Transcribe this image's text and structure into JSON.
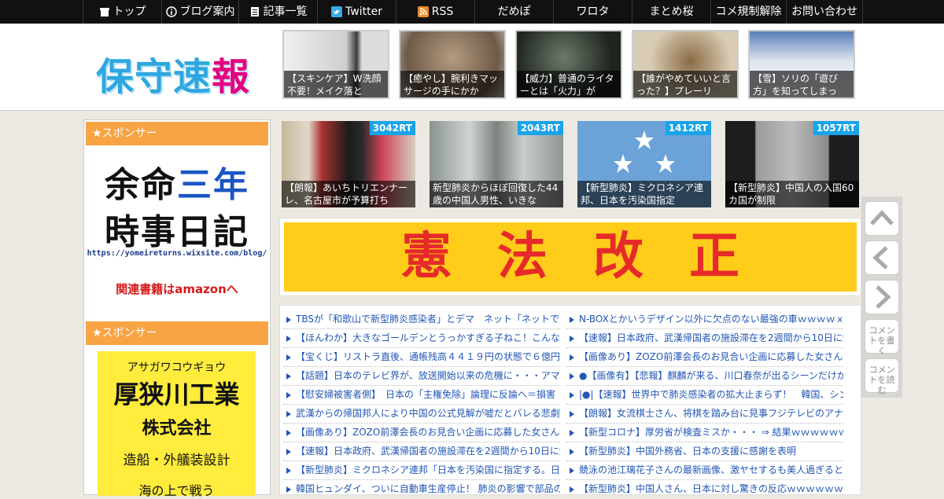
{
  "nav": {
    "items": [
      {
        "label": "トップ",
        "icon": "home-icon"
      },
      {
        "label": "ブログ案内",
        "icon": "info-icon"
      },
      {
        "label": "記事一覧",
        "icon": "list-icon"
      },
      {
        "label": "Twitter",
        "icon": "twitter-icon"
      },
      {
        "label": "RSS",
        "icon": "rss-icon"
      },
      {
        "label": "だめぽ",
        "icon": ""
      },
      {
        "label": "ワロタ",
        "icon": ""
      },
      {
        "label": "まとめ桜",
        "icon": ""
      },
      {
        "label": "コメ規制解除",
        "icon": ""
      },
      {
        "label": "お問い合わせ",
        "icon": ""
      }
    ]
  },
  "header": {
    "logo": [
      "保",
      "守",
      "速",
      "報"
    ],
    "pickups": [
      {
        "caption": "【スキンケア】W洗顔不要！メイク落と",
        "color": "#d9d9d9"
      },
      {
        "caption": "【癒やし】腕利きマッサージの手にかか",
        "color": "#8a7a6a"
      },
      {
        "caption": "【威力】普通のライターとは「火力」が",
        "color": "#3b4a3c"
      },
      {
        "caption": "【誰がやめていいと言った？】プレーリ",
        "color": "#b7a58a"
      },
      {
        "caption": "【雪】ソリの「遊び方」を知ってしまっ",
        "color": "#aebdd6"
      }
    ]
  },
  "sidebar": {
    "sponsor_heading_1": "★スポンサー",
    "sponsor_heading_2": "★スポンサー",
    "ad1": {
      "line1_a": "余命",
      "line1_b": "三年",
      "line2": "時事日記",
      "url": "https://yomeireturns.wixsite.com/blog/",
      "amazon": "関連書籍はamazonへ"
    },
    "ad2": {
      "kana": "アサガワコウギョウ",
      "name": "厚狭川工業",
      "corp": "株式会社",
      "desc": "造船・外艤装設計",
      "tail": "海の上で戦う"
    }
  },
  "ranking": [
    {
      "rt": "3042RT",
      "caption": "【朗報】あいちトリエンナーレ、名古屋市が予算打ち",
      "color": "#8b2a2a"
    },
    {
      "rt": "2043RT",
      "caption": "新型肺炎からほぼ回復した44歳の中国人男性、いきな",
      "color": "#9aa3a0"
    },
    {
      "rt": "1412RT",
      "caption": "【新型肺炎】ミクロネシア連邦、日本を汚染国指定",
      "color": "#6aa3d6"
    },
    {
      "rt": "1057RT",
      "caption": "【新型肺炎】中国人の入国60カ国が制限",
      "color": "#555555"
    }
  ],
  "banner": {
    "text": "憲法改正"
  },
  "headlines": {
    "left": [
      "TBSが「和歌山で新型肺炎感染者」とデマ　ネット「ネットで",
      "【ほんわか】大きなゴールデンとうっかすぎる子ねこ！こんな",
      "【宝くじ】リストラ直後、通帳残高４４１９円の状態で６億円",
      "【話題】日本のテレビ界が、放送開始以来の危機に・・・アマ",
      "【慰安婦被害者側】　日本の「主権免除」論理に反論へ＝損害",
      "武漢からの帰国邦人により中国の公式見解が嘘だとバレる悲劇",
      "【画像あり】ZOZO前澤会長のお見合い企画に応募した女さん、",
      "【速報】日本政府、武漢帰国者の施設滞在を2週間から10日に短",
      "【新型肺炎】ミクロネシア連邦「日本を汚染国に指定する。日",
      "韓国ヒュンダイ、ついに自動車生産停止！ 肺炎の影響で部品の"
    ],
    "right": [
      "N-BOXとかいうデザイン以外に欠点のない最強の車ｗｗｗｗｘ",
      "【速報】日本政府、武漢帰国者の施設滞在を2週間から10日に短",
      "【画像あり】ZOZO前澤会長のお見合い企画に応募した女さん、",
      "●【画像有】【悲報】麒麟が来る、川口春奈が出るシーンだけが",
      "|●|【速報】世界中で肺炎感染者の拡大止まらず！　韓国、シン",
      "【朗報】女流棋士さん、将棋を踏み台に見事フジテレビのアナ",
      "【新型コロナ】厚労省が検査ミスか・・・ ⇒ 結果ｗｗｗｗｗｗ",
      "【新型肺炎】中国外務省、日本の支援に感謝を表明",
      "競泳の池江璃花子さんの最新画像、激ヤセするも美人過ぎると",
      "【新型肺炎】中国人さん、日本に対し驚きの反応ｗｗｗｗｗｗ"
    ]
  },
  "sidebuttons": {
    "comment_write": "コメントを書く",
    "comment_read": "コメントを読む"
  }
}
